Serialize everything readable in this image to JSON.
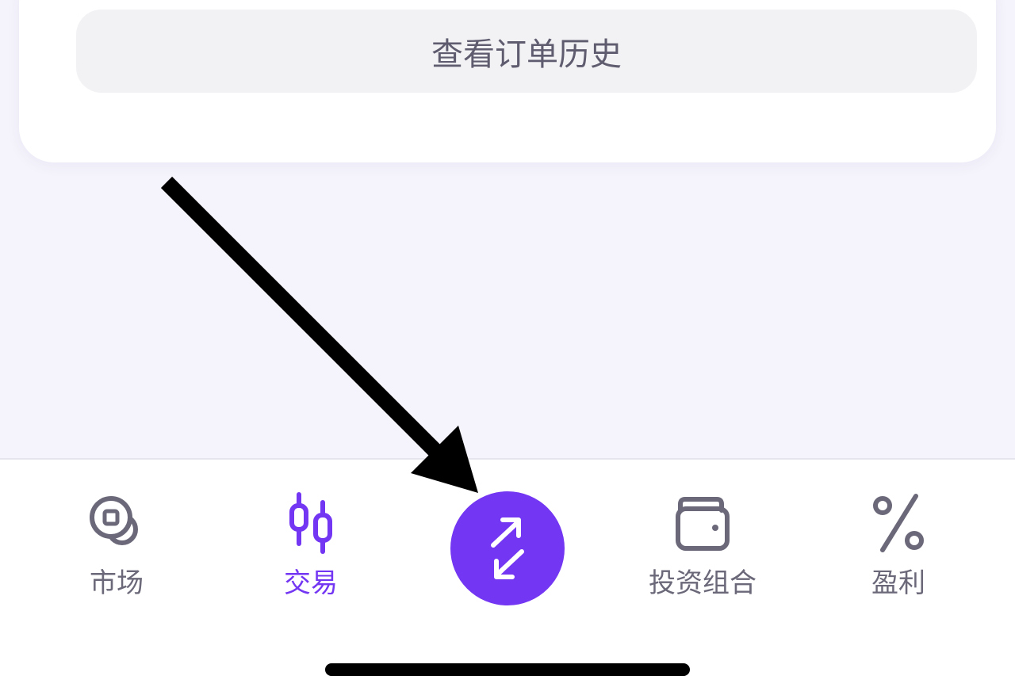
{
  "card": {
    "history_button_label": "查看订单历史"
  },
  "tabbar": {
    "items": [
      {
        "label": "市场",
        "icon": "coins-icon",
        "active": false
      },
      {
        "label": "交易",
        "icon": "candlestick-icon",
        "active": true
      },
      {
        "label": "投资组合",
        "icon": "wallet-icon",
        "active": false
      },
      {
        "label": "盈利",
        "icon": "percent-icon",
        "active": false
      }
    ],
    "center_action_icon": "swap-arrows-icon"
  },
  "colors": {
    "accent": "#7336f2",
    "inactive": "#6b6879",
    "background": "#f5f4fc",
    "button_bg": "#f2f2f4"
  }
}
